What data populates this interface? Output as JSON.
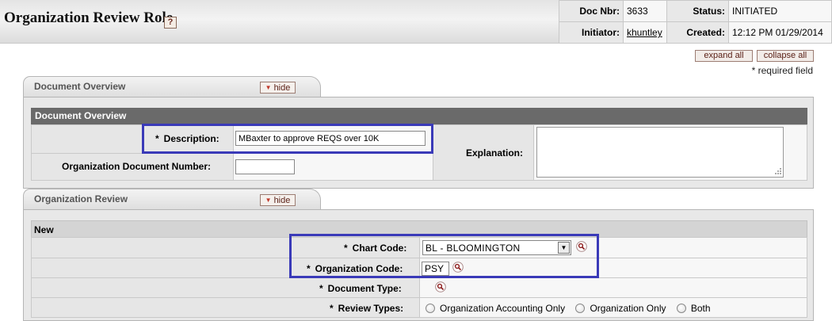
{
  "header": {
    "title": "Organization Review Role",
    "help_icon": "?",
    "doc_nbr_label": "Doc Nbr:",
    "doc_nbr": "3633",
    "status_label": "Status:",
    "status": "INITIATED",
    "initiator_label": "Initiator:",
    "initiator": "khuntley",
    "created_label": "Created:",
    "created": "12:12 PM 01/29/2014"
  },
  "controls": {
    "expand_all": "expand all",
    "collapse_all": "collapse all",
    "required_note": "* required field"
  },
  "document_overview": {
    "tab_label": "Document Overview",
    "hide_label": "hide",
    "section_title": "Document Overview",
    "description_label": "Description:",
    "description_value": "MBaxter to approve REQS over 10K",
    "org_doc_number_label": "Organization Document Number:",
    "org_doc_number_value": "",
    "explanation_label": "Explanation:",
    "explanation_value": ""
  },
  "organization_review": {
    "tab_label": "Organization Review",
    "hide_label": "hide",
    "section_title": "New",
    "chart_code_label": "Chart Code:",
    "chart_code_value": "BL -  BLOOMINGTON",
    "org_code_label": "Organization Code:",
    "org_code_value": "PSY",
    "document_type_label": "Document Type:",
    "review_types_label": "Review Types:",
    "review_type_options": [
      "Organization Accounting Only",
      "Organization Only",
      "Both"
    ]
  },
  "required_marker": "*",
  "icons": {
    "lookup": "magnifier-icon",
    "hide_arrow": "triangle-down-icon",
    "resize": "resize-grip-icon"
  },
  "colors": {
    "highlight": "#3a3ab8",
    "section_header": "#6a6a6a",
    "button_text": "#5b2117"
  }
}
